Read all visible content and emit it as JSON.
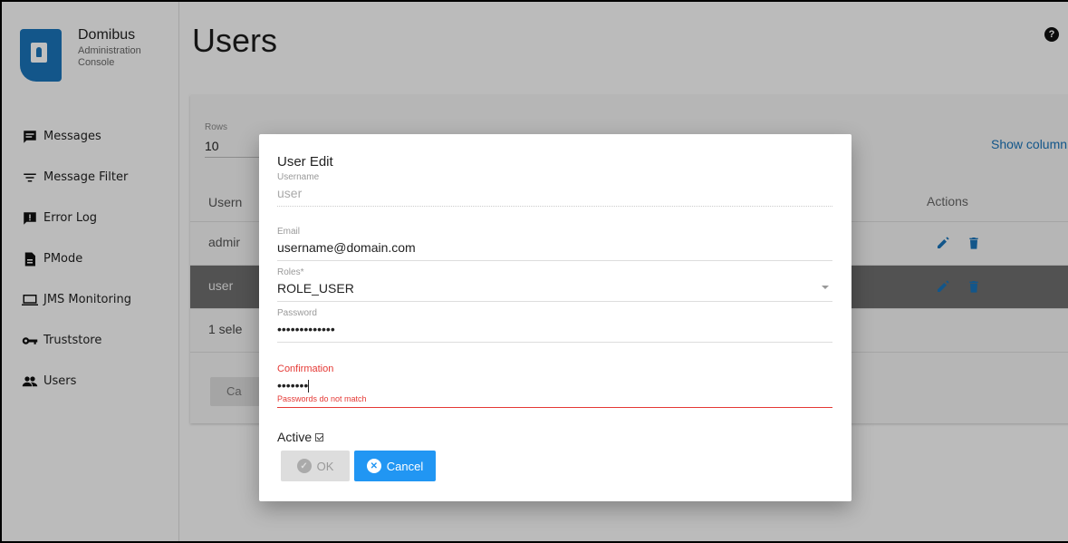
{
  "brand": {
    "name": "Domibus",
    "subtitle": "Administration Console"
  },
  "sidebar": {
    "items": [
      {
        "label": "Messages",
        "icon": "message-icon"
      },
      {
        "label": "Message Filter",
        "icon": "filter-icon"
      },
      {
        "label": "Error Log",
        "icon": "error-log-icon"
      },
      {
        "label": "PMode",
        "icon": "document-icon"
      },
      {
        "label": "JMS Monitoring",
        "icon": "monitor-icon"
      },
      {
        "label": "Truststore",
        "icon": "key-icon"
      },
      {
        "label": "Users",
        "icon": "users-icon"
      }
    ]
  },
  "main": {
    "title": "Users",
    "rows_label": "Rows",
    "rows_value": "10",
    "show_columns": "Show column",
    "table": {
      "header_user": "Usern",
      "header_actions": "Actions",
      "rows": [
        {
          "user": "admir"
        },
        {
          "user": "user"
        }
      ],
      "footer": "1 sele"
    },
    "cancel_small": "Ca"
  },
  "dialog": {
    "title": "User Edit",
    "username": {
      "label": "Username",
      "value": "user"
    },
    "email": {
      "label": "Email",
      "value": "username@domain.com"
    },
    "roles": {
      "label": "Roles*",
      "value": "ROLE_USER"
    },
    "password": {
      "label": "Password",
      "value": "•••••••••••••"
    },
    "confirmation": {
      "label": "Confirmation",
      "value": "•••••••",
      "error": "Passwords do not match"
    },
    "active_label": "Active",
    "ok_label": "OK",
    "cancel_label": "Cancel"
  },
  "colors": {
    "accent": "#2196f3",
    "error": "#e53935",
    "brand": "#1a73b8"
  }
}
